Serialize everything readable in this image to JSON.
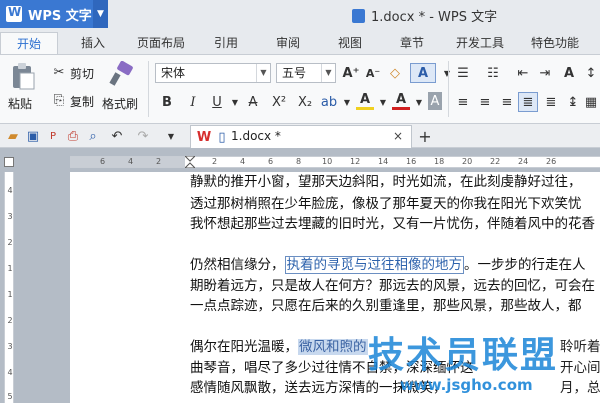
{
  "app": {
    "name": "WPS 文字",
    "document_title": "1.docx * - WPS 文字"
  },
  "tabs": [
    "开始",
    "插入",
    "页面布局",
    "引用",
    "审阅",
    "视图",
    "章节",
    "开发工具",
    "特色功能"
  ],
  "ribbon": {
    "paste_label": "粘贴",
    "cut_label": "剪切",
    "copy_label": "复制",
    "format_painter_label": "格式刷",
    "font_name": "宋体",
    "font_size": "五号",
    "increase_font": "A⁺",
    "decrease_font": "A⁻",
    "bold": "B",
    "italic": "I",
    "underline": "U",
    "superscript": "X²",
    "subscript": "X₂",
    "font_color": "A",
    "text_highlight": "A"
  },
  "doc_tab": {
    "label": "1.docx *",
    "close": "×"
  },
  "ruler": {
    "h": [
      "6",
      "4",
      "2",
      "2",
      "4",
      "6",
      "8",
      "10",
      "12",
      "14",
      "16",
      "18",
      "20",
      "22",
      "24",
      "26"
    ],
    "v": [
      "4",
      "3",
      "2",
      "1",
      "1",
      "2",
      "3",
      "4",
      "5"
    ]
  },
  "document": {
    "lines": [
      "静默的推开小窗，望那天边斜阳，时光如流，在此刻虔静好过往，",
      "透过那树梢照在少年脸庞，像极了那年夏天的你我在阳光下欢笑忧",
      "我怀想起那些过去埋藏的旧时光，又有一片忧伤，伴随着风中的花香",
      "",
      "仍然相信缘分，",
      "期盼着远方，只是故人在何方？那远去的风景，远去的回忆，可会在",
      "一点点踪迹，只愿在后来的久别重逢里，那些风景，那些故人，都",
      "",
      "偶尔在阳光温暖，",
      "曲琴音，唱尽了多少过往情不自禁，深深缅怀这",
      "感情随风飘散，送去远方深情的一抹微笑，"
    ],
    "boxed_phrase": "执着的寻觅与过往相像的地方",
    "after_boxed": "。一步步的行走在人",
    "selected_phrase": "微风和煦的",
    "after_selected": "午后，静静的聆听着",
    "line9_tail": "聆听着",
    "line10_tail": "开心间",
    "line11_tail": "月，总会"
  },
  "watermark": {
    "text": "技术员联盟",
    "url": "www.jsgho.com"
  },
  "colors": {
    "accent": "#3a78d2",
    "tab_active": "#2b6fd0",
    "selection": "#c7d8ee",
    "box": "#6b8fc2"
  }
}
